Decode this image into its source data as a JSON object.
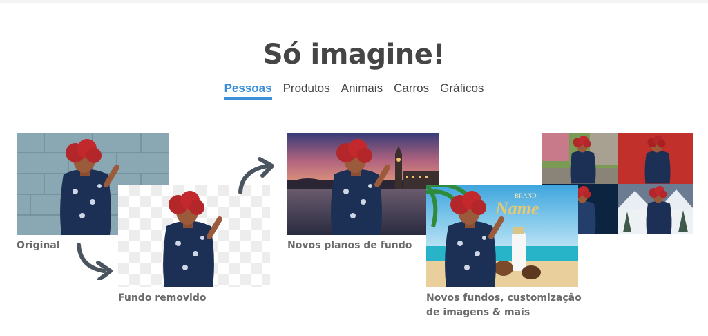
{
  "page": {
    "title": "Só imagine!",
    "tabs": [
      {
        "label": "Pessoas",
        "active": true
      },
      {
        "label": "Produtos",
        "active": false
      },
      {
        "label": "Animais",
        "active": false
      },
      {
        "label": "Carros",
        "active": false
      },
      {
        "label": "Gráficos",
        "active": false
      }
    ]
  },
  "steps": {
    "original": "Original",
    "removed": "Fundo removido",
    "backgrounds": "Novos planos de fundo",
    "custom_line1": "Novos fundos, customização",
    "custom_line2": "de imagens & mais"
  },
  "custom_image": {
    "brand": "BRAND",
    "name": "Name"
  },
  "colors": {
    "accent": "#3b8ed8",
    "title": "#454545",
    "caption": "#6b6b6b",
    "arrow": "#4a5560"
  },
  "icons": [
    "curved-arrow-down-icon",
    "curved-arrow-up-icon"
  ]
}
